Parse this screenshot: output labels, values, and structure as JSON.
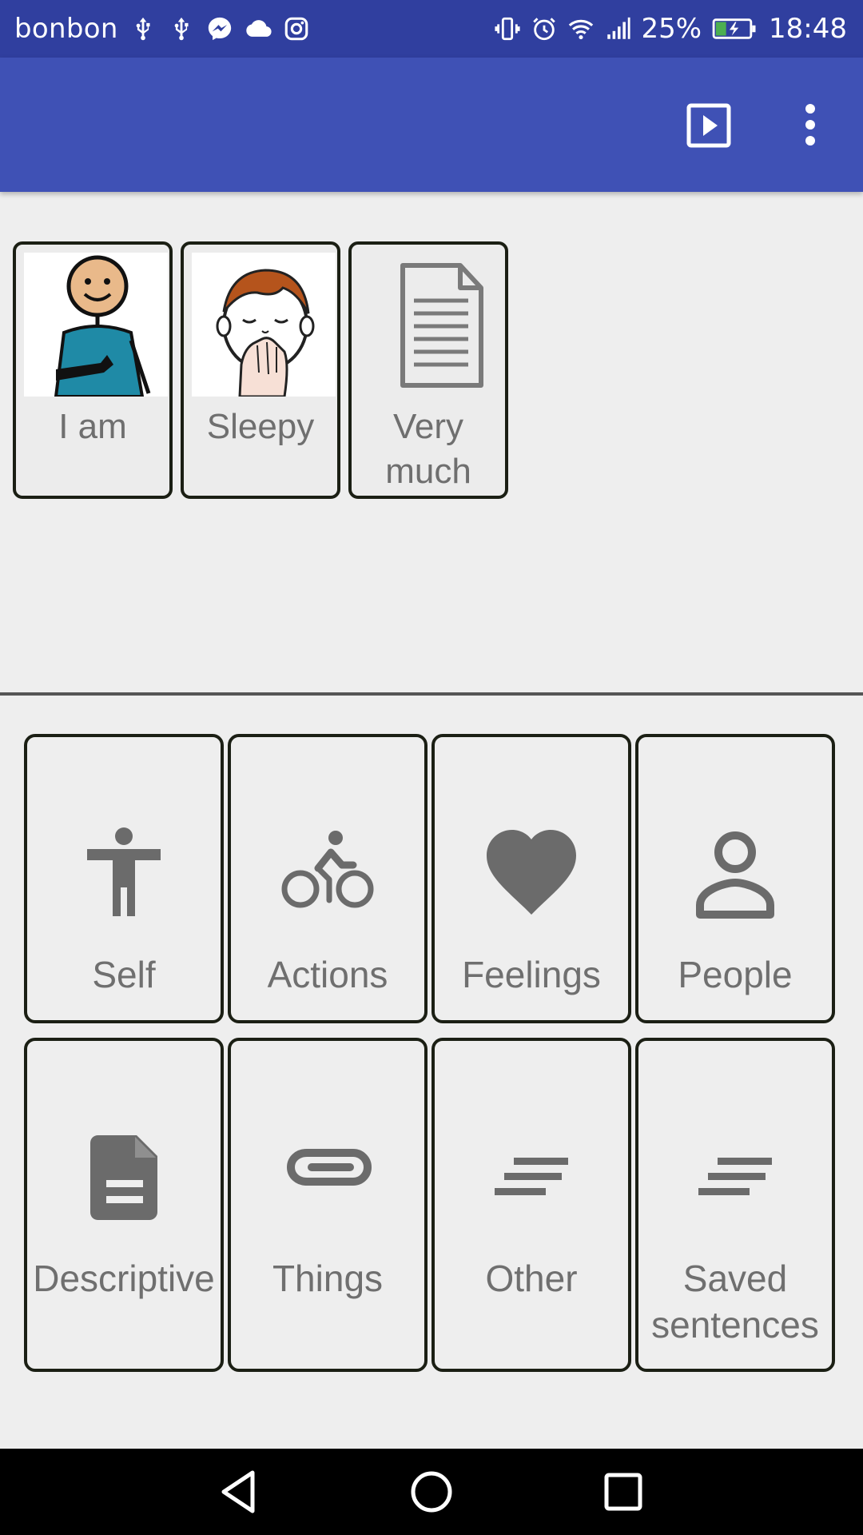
{
  "status_bar": {
    "carrier": "bonbon",
    "battery": "25%",
    "time": "18:48",
    "left_icons": [
      "usb-icon",
      "usb-icon",
      "messenger-icon",
      "cloud-icon",
      "instagram-icon"
    ],
    "right_icons": [
      "vibrate-icon",
      "alarm-icon",
      "wifi-icon",
      "signal-icon",
      "battery-charging-icon"
    ]
  },
  "app_bar": {
    "bg_color": "#3f51b5",
    "actions": [
      "play-icon",
      "more-vert-icon"
    ]
  },
  "sentence": {
    "words": [
      {
        "label": "I am",
        "icon": "person-pointing-self-icon"
      },
      {
        "label": "Sleepy",
        "icon": "yawning-boy-icon"
      },
      {
        "label": "Very\nmuch",
        "icon": "document-icon"
      }
    ]
  },
  "categories": [
    {
      "label": "Self",
      "icon": "accessibility-icon"
    },
    {
      "label": "Actions",
      "icon": "bike-icon"
    },
    {
      "label": "Feelings",
      "icon": "heart-icon"
    },
    {
      "label": "People",
      "icon": "person-icon"
    },
    {
      "label": "Descriptive",
      "icon": "description-icon"
    },
    {
      "label": "Things",
      "icon": "attachment-icon"
    },
    {
      "label": "Other",
      "icon": "short-text-icon"
    },
    {
      "label": "Saved sentences",
      "icon": "short-text-icon"
    }
  ],
  "nav_bar": {
    "buttons": [
      "back-icon",
      "home-icon",
      "recents-icon"
    ]
  }
}
